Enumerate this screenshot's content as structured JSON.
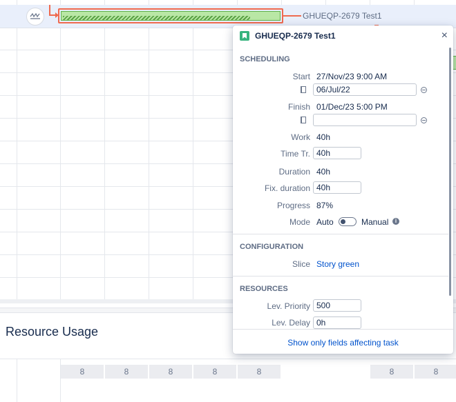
{
  "gantt": {
    "task_label": "GHUEQP-2679  Test1",
    "progress": 0.87
  },
  "resource_usage": {
    "title": "Resource Usage",
    "cells": [
      "8",
      "8",
      "8",
      "8",
      "8",
      "8",
      "8"
    ]
  },
  "popup": {
    "title": "GHUEQP-2679 Test1",
    "close_label": "×",
    "sections": {
      "scheduling": "SCHEDULING",
      "configuration": "CONFIGURATION",
      "resources": "RESOURCES"
    },
    "fields": {
      "start_label": "Start",
      "start_value": "27/Nov/23 9:00 AM",
      "start_input": "06/Jul/22",
      "finish_label": "Finish",
      "finish_value": "01/Dec/23 5:00 PM",
      "finish_input": "",
      "work_label": "Work",
      "work_value": "40h",
      "time_tr_label": "Time Tr.",
      "time_tr_input": "40h",
      "duration_label": "Duration",
      "duration_value": "40h",
      "fix_duration_label": "Fix. duration",
      "fix_duration_input": "40h",
      "progress_label": "Progress",
      "progress_value": "87%",
      "mode_label": "Mode",
      "mode_auto": "Auto",
      "mode_manual": "Manual",
      "info_glyph": "i",
      "slice_label": "Slice",
      "slice_value": "Story green",
      "lev_priority_label": "Lev. Priority",
      "lev_priority_input": "500",
      "lev_delay_label": "Lev. Delay",
      "lev_delay_input": "0h"
    },
    "footer_link": "Show only fields affecting task"
  },
  "colors": {
    "accent": "#ef6a4f",
    "bar_fill": "#b9e7a5",
    "link": "#0052cc"
  }
}
